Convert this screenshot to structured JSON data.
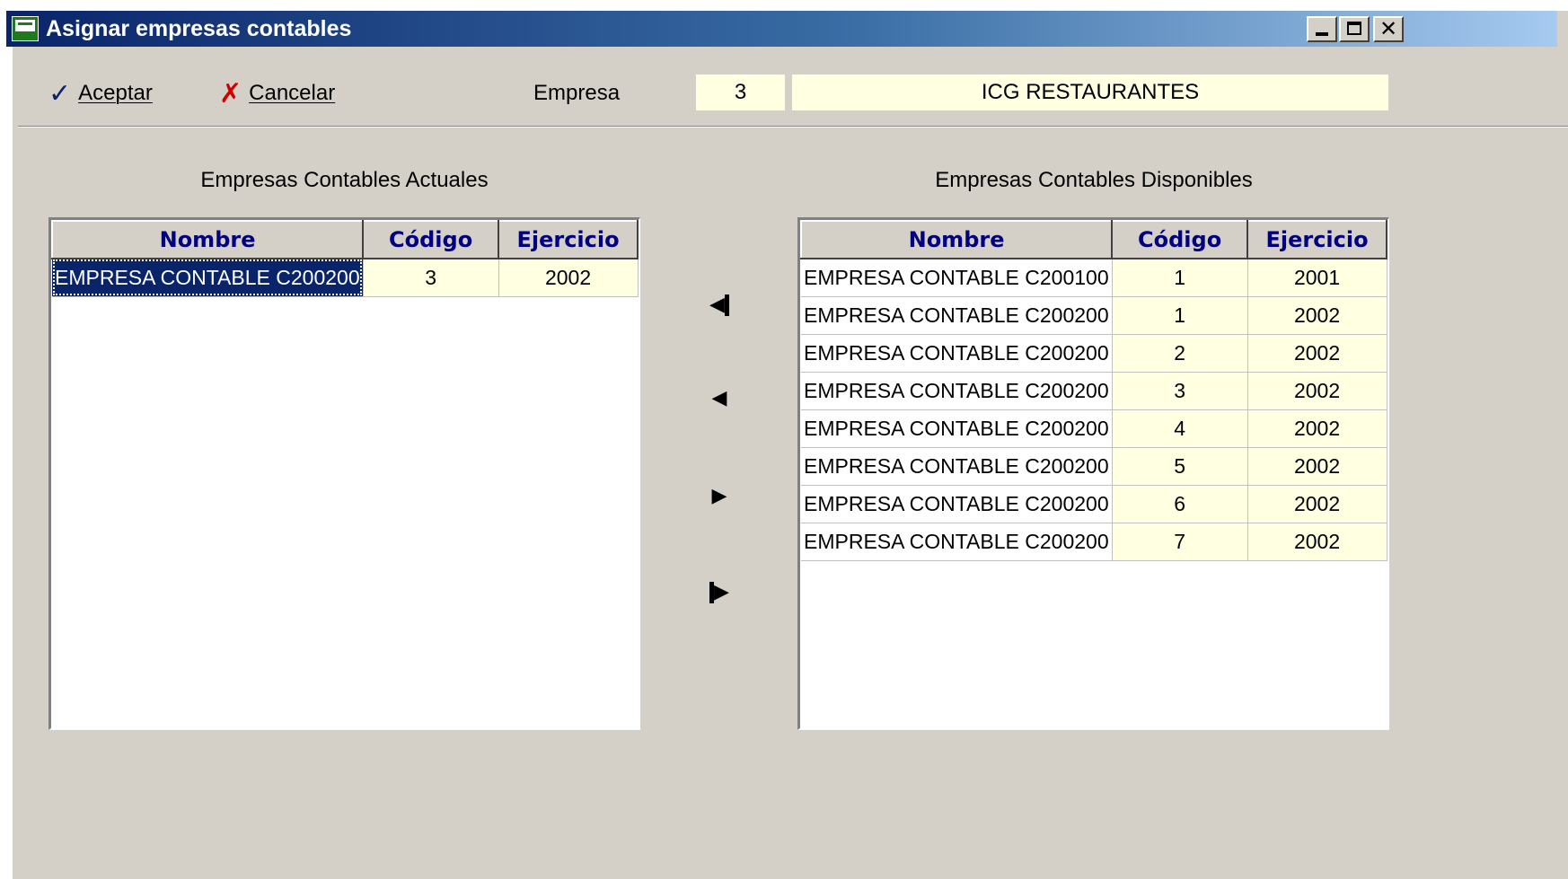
{
  "window": {
    "title": "Asignar empresas contables"
  },
  "toolbar": {
    "accept_label": "Aceptar",
    "cancel_label": "Cancelar",
    "empresa_label": "Empresa",
    "empresa_code": "3",
    "empresa_name": "ICG RESTAURANTES"
  },
  "left_panel": {
    "title": "Empresas Contables Actuales",
    "columns": [
      "Nombre",
      "Código",
      "Ejercicio"
    ],
    "rows": [
      {
        "nombre": "EMPRESA CONTABLE C200200",
        "codigo": "3",
        "ejercicio": "2002"
      }
    ]
  },
  "right_panel": {
    "title": "Empresas Contables Disponibles",
    "columns": [
      "Nombre",
      "Código",
      "Ejercicio"
    ],
    "rows": [
      {
        "nombre": "EMPRESA CONTABLE C200100",
        "codigo": "1",
        "ejercicio": "2001"
      },
      {
        "nombre": "EMPRESA CONTABLE C200200",
        "codigo": "1",
        "ejercicio": "2002"
      },
      {
        "nombre": "EMPRESA CONTABLE C200200",
        "codigo": "2",
        "ejercicio": "2002"
      },
      {
        "nombre": "EMPRESA CONTABLE C200200",
        "codigo": "3",
        "ejercicio": "2002"
      },
      {
        "nombre": "EMPRESA CONTABLE C200200",
        "codigo": "4",
        "ejercicio": "2002"
      },
      {
        "nombre": "EMPRESA CONTABLE C200200",
        "codigo": "5",
        "ejercicio": "2002"
      },
      {
        "nombre": "EMPRESA CONTABLE C200200",
        "codigo": "6",
        "ejercicio": "2002"
      },
      {
        "nombre": "EMPRESA CONTABLE C200200",
        "codigo": "7",
        "ejercicio": "2002"
      }
    ]
  },
  "icons": {
    "accept": "check-icon",
    "cancel": "x-icon",
    "move_all_left": "move-all-left-icon",
    "move_left": "move-left-icon",
    "move_right": "move-right-icon",
    "move_all_right": "move-all-right-icon"
  },
  "colors": {
    "titlebar_start": "#0a246a",
    "titlebar_end": "#a6caf0",
    "window_bg": "#d4d0c8",
    "input_bg": "#ffffe1",
    "header_text": "#000080",
    "selection_bg": "#0a246a"
  }
}
